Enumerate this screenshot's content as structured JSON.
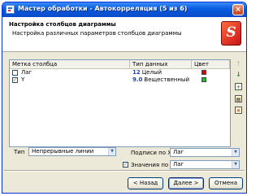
{
  "window": {
    "title": "Мастер обработки - Автокорреляция (5 из 6)",
    "close_glyph": "×"
  },
  "header": {
    "title": "Настройка столбцов диаграммы",
    "subtitle": "Настройка различных параметров столбцов диаграммы",
    "logo_glyph": "S"
  },
  "grid": {
    "columns": [
      "Метка столбца",
      "Тип данных",
      "Цвет"
    ],
    "rows": [
      {
        "checked": false,
        "label": "Лаг",
        "type_code": "12",
        "type_name": "Целый",
        "color": "#e00000"
      },
      {
        "checked": true,
        "label": "Y",
        "type_code": "9.0",
        "type_name": "Вещественный",
        "color": "#19c119"
      }
    ]
  },
  "side_icons": [
    "arrow-up-icon",
    "arrow-down-icon",
    "add-column-icon",
    "properties-icon",
    "delete-icon"
  ],
  "type_field": {
    "label": "Тип",
    "value": "Непрерывные линии"
  },
  "x_labels": {
    "label": "Подписи по X",
    "value": "Лаг"
  },
  "x_values": {
    "checked": true,
    "label": "Значения по X",
    "value": "Лаг"
  },
  "buttons": {
    "back": "< Назад",
    "next": "Далее >",
    "cancel": "Отмена"
  },
  "colors": {
    "titlebar": "#0a5fe0",
    "window_bg": "#ece9d8",
    "accent_blue": "#1f3fbf"
  }
}
